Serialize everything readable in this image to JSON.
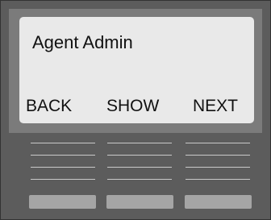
{
  "screen": {
    "title": "Agent Admin"
  },
  "softkeys": {
    "back": "BACK",
    "show": "SHOW",
    "next": "NEXT"
  },
  "colors": {
    "device_body": "#5c5c5c",
    "bezel": "#7b7b7b",
    "screen_bg": "#e9e9e9",
    "button": "#a5a5a5",
    "line": "#c9c9c9"
  }
}
